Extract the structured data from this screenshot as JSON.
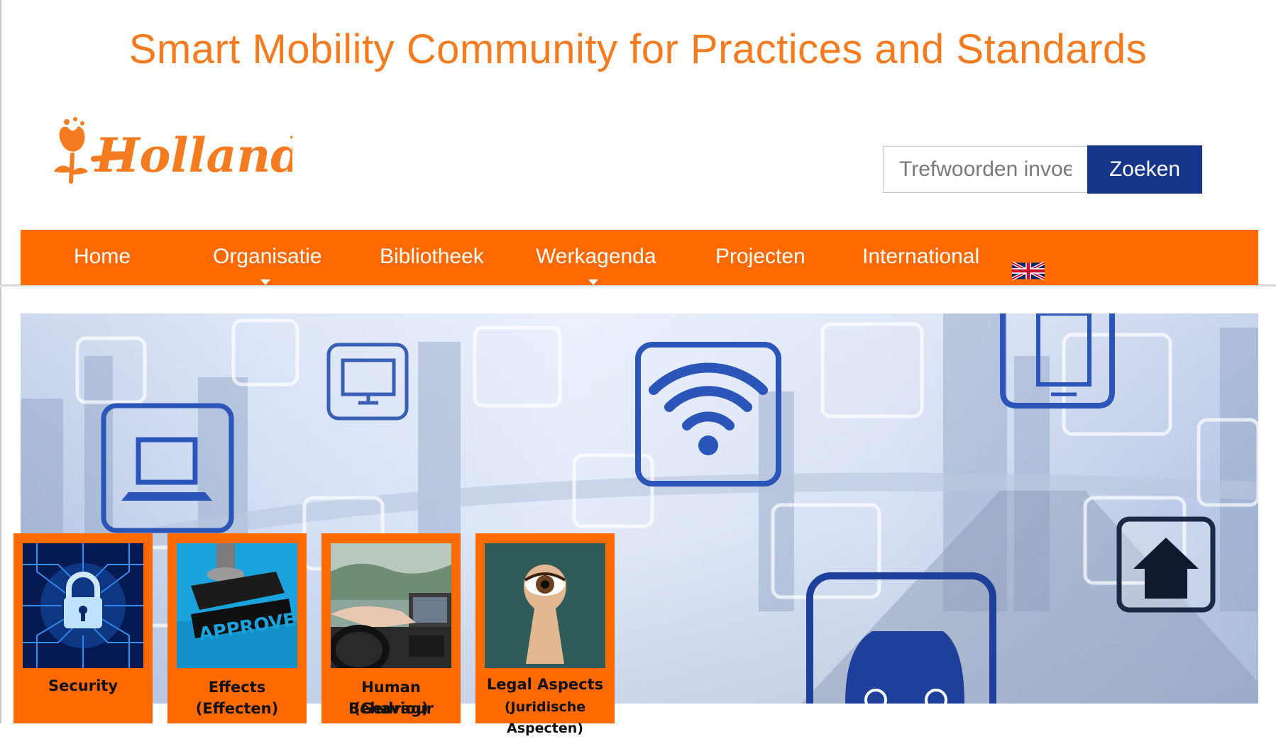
{
  "header": {
    "title": "Smart Mobility Community for Practices and Standards",
    "logo_text": "Holland"
  },
  "search": {
    "placeholder": "Trefwoorden invoe",
    "button_label": "Zoeken"
  },
  "nav": {
    "items": [
      {
        "label": "Home",
        "has_dropdown": false
      },
      {
        "label": "Organisatie",
        "has_dropdown": true
      },
      {
        "label": "Bibliotheek",
        "has_dropdown": false
      },
      {
        "label": "Werkagenda",
        "has_dropdown": true
      },
      {
        "label": "Projecten",
        "has_dropdown": false
      },
      {
        "label": "International",
        "has_dropdown": false
      }
    ],
    "language_flag": "uk-flag-icon"
  },
  "banner": {
    "icons": [
      "monitor-icon",
      "laptop-icon",
      "wifi-icon",
      "phone-icon",
      "home-icon",
      "car-icon"
    ]
  },
  "tiles": [
    {
      "line1": "Security",
      "line2": "",
      "image": "padlock-circuit-image"
    },
    {
      "line1": "Effects",
      "line2": "(Effecten)",
      "image": "approved-stamp-image",
      "stamp_text": "APPROVED"
    },
    {
      "line1": "Human Behaviour",
      "line2": "(Gedrag)",
      "image": "driver-image"
    },
    {
      "line1": "Legal Aspects",
      "line2": "(Juridische Aspecten)",
      "image": "keyhole-eye-image"
    }
  ],
  "colors": {
    "accent_orange": "#ff6a00",
    "title_orange": "#f47b20",
    "button_blue": "#15358a",
    "icon_blue": "#2b55b8"
  }
}
